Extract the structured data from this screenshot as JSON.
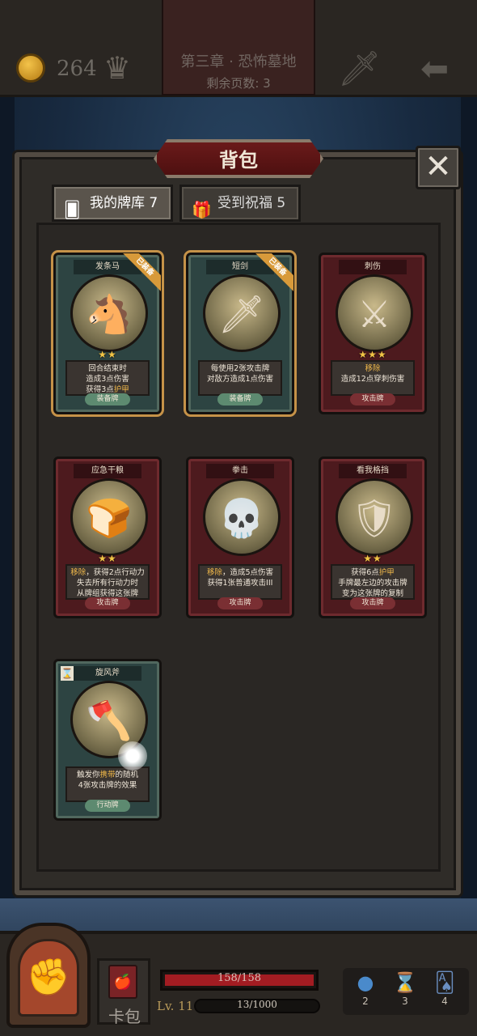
{
  "header": {
    "coins": "264",
    "chapter_title": "第三章 · 恐怖墓地",
    "pages_left": "剩余页数: 3"
  },
  "panel": {
    "title": "背包",
    "close_label": "✕",
    "tabs": [
      {
        "label": "我的牌库 7"
      },
      {
        "label": "受到祝福 5"
      }
    ]
  },
  "cards": [
    {
      "name": "发条马",
      "stars": "★★",
      "desc_pre": "回合结束时\n造成3点伤害\n获得3点",
      "desc_hl": "护甲",
      "desc_post": "",
      "type": "装备牌",
      "badge": "已装备",
      "color": "green"
    },
    {
      "name": "短剑",
      "stars": "",
      "desc_pre": "每使用2张攻击牌\n对敌方造成1点伤害",
      "desc_hl": "",
      "desc_post": "",
      "type": "装备牌",
      "badge": "已装备",
      "color": "green"
    },
    {
      "name": "刺伤",
      "stars": "★★★",
      "desc_pre": "",
      "desc_hl": "移除",
      "desc_post": "\n造成12点穿刺伤害",
      "type": "攻击牌",
      "badge": "",
      "color": "red"
    },
    {
      "name": "应急干粮",
      "stars": "★★",
      "desc_pre": "",
      "desc_hl": "移除",
      "desc_post": "，获得2点行动力\n失去所有行动力时\n从牌组获得这张牌",
      "type": "攻击牌",
      "badge": "",
      "color": "red"
    },
    {
      "name": "拳击",
      "stars": "",
      "desc_pre": "",
      "desc_hl": "移除",
      "desc_post": "，造成5点伤害\n获得1张普通攻击III",
      "type": "攻击牌",
      "badge": "",
      "color": "red"
    },
    {
      "name": "看我格挡",
      "stars": "★★",
      "desc_pre": "获得6点",
      "desc_hl": "护甲",
      "desc_post": "\n手牌最左边的攻击牌\n变为这张牌的复制",
      "type": "攻击牌",
      "badge": "",
      "color": "red"
    },
    {
      "name": "旋风斧",
      "stars": "",
      "desc_pre": "触发你",
      "desc_hl": "携带",
      "desc_post": "的随机\n4张攻击牌的效果",
      "type": "行动牌",
      "badge": "",
      "color": "green"
    }
  ],
  "footer": {
    "cardpack_label": "卡包",
    "hp_text": "158/158",
    "hp_fraction": 1.0,
    "level": "Lv. 11",
    "xp_text": "13/1000",
    "resources": [
      {
        "icon": "orb-icon",
        "value": "2"
      },
      {
        "icon": "hourglass-icon",
        "value": "3"
      },
      {
        "icon": "cards-icon",
        "value": "4"
      }
    ]
  }
}
